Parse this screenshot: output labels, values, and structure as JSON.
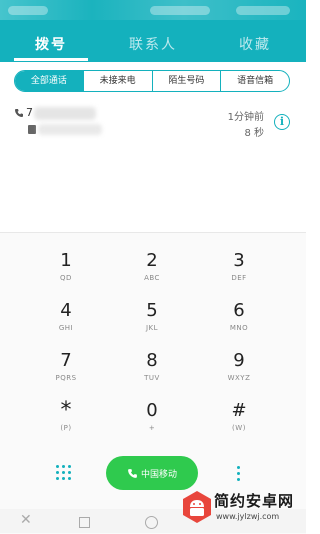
{
  "tabs": [
    {
      "label": "拨号"
    },
    {
      "label": "联系人"
    },
    {
      "label": "收藏"
    }
  ],
  "filters": [
    {
      "label": "全部通话"
    },
    {
      "label": "未接来电"
    },
    {
      "label": "陌生号码"
    },
    {
      "label": "语音信箱"
    }
  ],
  "call_log": {
    "number_prefix": "7",
    "time": "1分钟前",
    "duration": "8 秒"
  },
  "keypad": [
    {
      "digit": "1",
      "letters": "QD"
    },
    {
      "digit": "2",
      "letters": "ABC"
    },
    {
      "digit": "3",
      "letters": "DEF"
    },
    {
      "digit": "4",
      "letters": "GHI"
    },
    {
      "digit": "5",
      "letters": "JKL"
    },
    {
      "digit": "6",
      "letters": "MNO"
    },
    {
      "digit": "7",
      "letters": "PQRS"
    },
    {
      "digit": "8",
      "letters": "TUV"
    },
    {
      "digit": "9",
      "letters": "WXYZ"
    },
    {
      "digit": "*",
      "letters": "(P)"
    },
    {
      "digit": "0",
      "letters": "+"
    },
    {
      "digit": "#",
      "letters": "(W)"
    }
  ],
  "call_button": {
    "label": "中国移动"
  },
  "watermark": {
    "title": "简约安卓网",
    "url": "www.jylzwj.com"
  },
  "colors": {
    "accent": "#14b1bd",
    "call_green": "#2fca4e"
  }
}
